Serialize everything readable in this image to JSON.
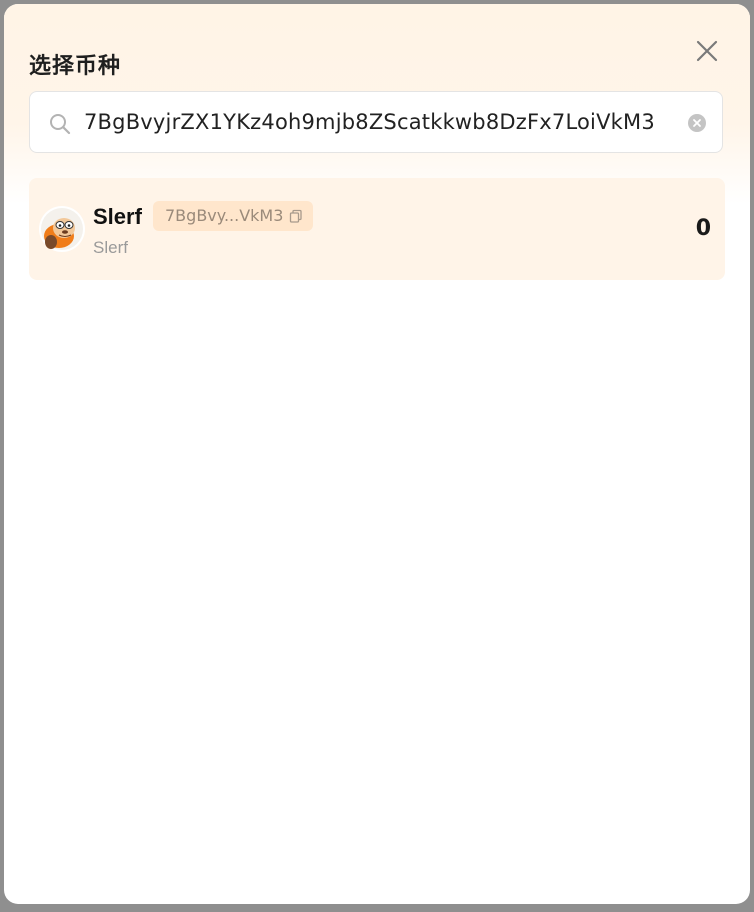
{
  "modal": {
    "title": "选择币种",
    "close_icon": "close-icon"
  },
  "search": {
    "value": "7BgBvyjrZX1YKz4oh9mjb8ZScatkkwb8DzFx7LoiVkM3",
    "search_icon": "search-icon",
    "clear_icon": "clear-circle-icon"
  },
  "tokens": [
    {
      "symbol": "Slerf",
      "name": "Slerf",
      "address_short": "7BgBvy...VkM3",
      "balance": "0",
      "avatar_icon": "slerf-token-logo",
      "copy_icon": "copy-icon"
    }
  ],
  "colors": {
    "header_tint": "#fff4e6",
    "row_bg": "#fff4e8",
    "chip_bg": "#ffe6cc",
    "token_orange": "#f07d1a"
  }
}
